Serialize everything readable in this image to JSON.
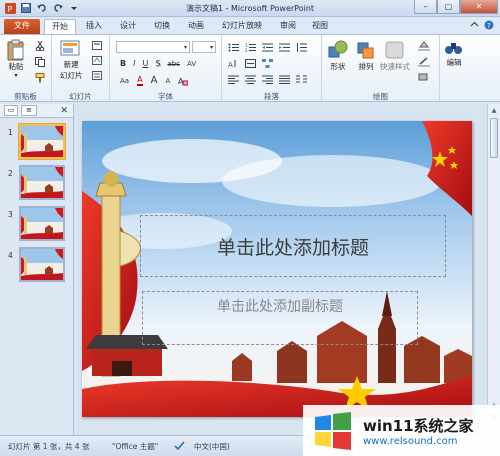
{
  "window": {
    "title": "演示文稿1 - Microsoft PowerPoint",
    "minimize": "–",
    "restore": "▢",
    "close": "✕"
  },
  "tabs": [
    "文件",
    "开始",
    "插入",
    "设计",
    "切换",
    "动画",
    "幻灯片放映",
    "审阅",
    "视图"
  ],
  "ribbon": {
    "groups": {
      "clipboard": "剪贴板",
      "slides": "幻灯片",
      "font": "字体",
      "paragraph": "段落",
      "drawing": "绘图",
      "editing": ""
    },
    "paste": "粘贴",
    "new_slide_1": "新建",
    "new_slide_2": "幻灯片",
    "shapes": "形状",
    "arrange": "排列",
    "quick_styles": "快速样式",
    "edit": "编辑",
    "font_buttons": [
      "B",
      "I",
      "U",
      "S",
      "abc",
      "AV",
      "Aa",
      "A"
    ],
    "grow_shrink": [
      "A",
      "A"
    ]
  },
  "left_pane": {
    "slides": [
      {
        "num": "1",
        "selected": true
      },
      {
        "num": "2",
        "selected": false
      },
      {
        "num": "3",
        "selected": false
      },
      {
        "num": "4",
        "selected": false
      }
    ],
    "close": "✕"
  },
  "slide": {
    "title_placeholder": "单击此处添加标题",
    "subtitle_placeholder": "单击此处添加副标题"
  },
  "status": {
    "slide_info": "幻灯片 第 1 张，共 4 张",
    "theme": "\"Office 主题\"",
    "language": "中文(中国)"
  },
  "watermark": {
    "brand": "win11系统之家",
    "url": "www.relsound.com"
  },
  "colors": {
    "file_tab": "#c44a1e",
    "sky_top": "#7fb4e0",
    "red_flag": "#d2181c",
    "ribbon_border": "#a9bfd6"
  }
}
